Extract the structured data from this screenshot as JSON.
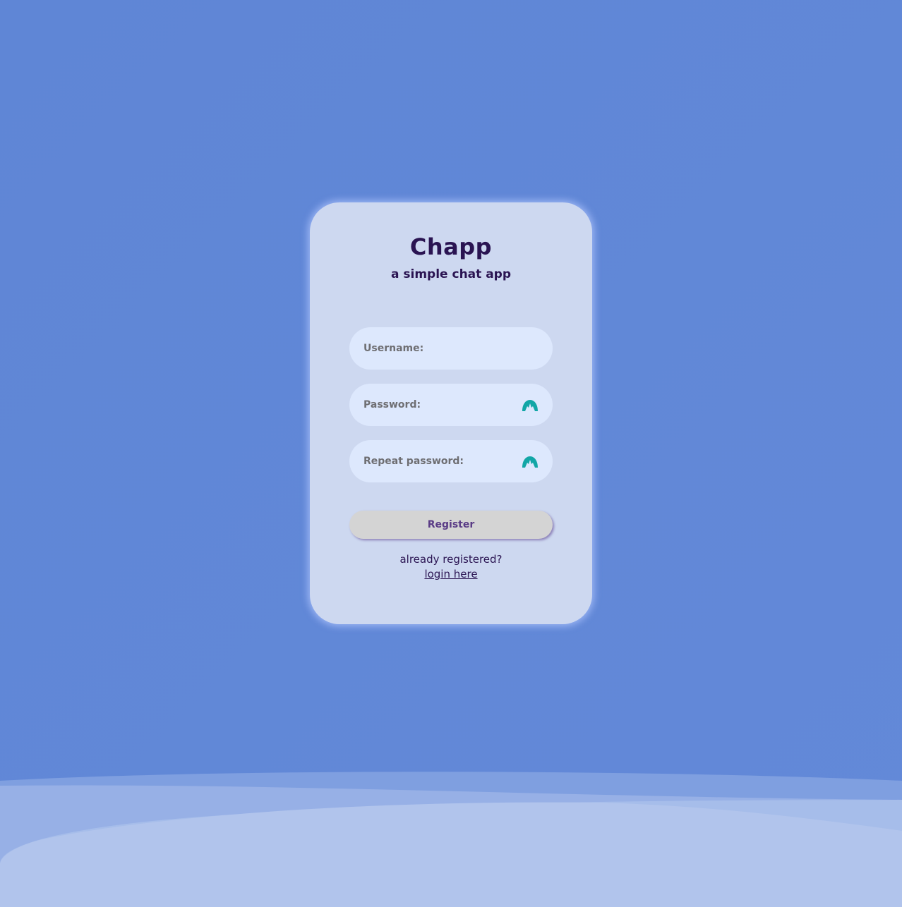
{
  "app": {
    "title": "Chapp",
    "subtitle": "a simple chat app"
  },
  "form": {
    "username_label": "Username:",
    "password_label": "Password:",
    "repeat_password_label": "Repeat password:",
    "username_value": "",
    "password_value": "",
    "repeat_password_value": "",
    "register_label": "Register"
  },
  "footer": {
    "already_text": "already registered?",
    "login_link": "login here"
  },
  "icons": {
    "password_toggle": "eye-icon",
    "repeat_password_toggle": "eye-icon"
  },
  "colors": {
    "background": "#6188d7",
    "card": "#cdd8f0",
    "field": "#dde8fd",
    "title": "#2a1452",
    "icon": "#12a6a6",
    "button": "#d4d4d4",
    "button_text": "#5a3c86"
  }
}
